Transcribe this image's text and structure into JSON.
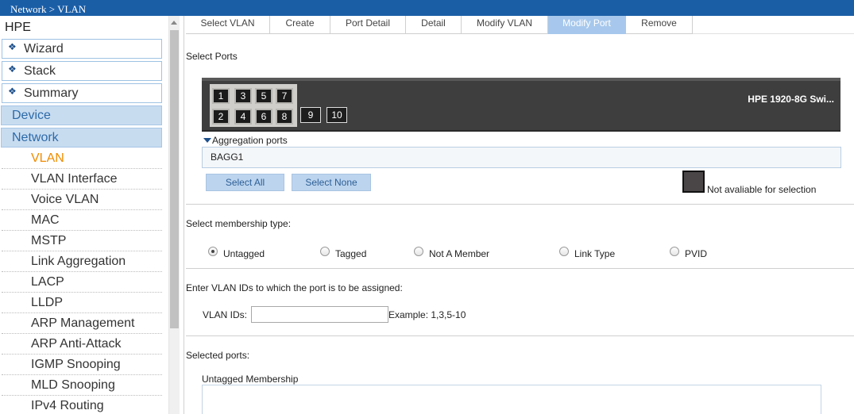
{
  "topbar": {
    "breadcrumb": "Network > VLAN"
  },
  "sidebar": {
    "root": "HPE",
    "groups": [
      {
        "label": "Wizard"
      },
      {
        "label": "Stack"
      },
      {
        "label": "Summary"
      }
    ],
    "sections": [
      {
        "label": "Device"
      },
      {
        "label": "Network"
      }
    ],
    "items": [
      {
        "label": "VLAN",
        "active": true
      },
      {
        "label": "VLAN Interface"
      },
      {
        "label": "Voice VLAN"
      },
      {
        "label": "MAC"
      },
      {
        "label": "MSTP"
      },
      {
        "label": "Link Aggregation"
      },
      {
        "label": "LACP"
      },
      {
        "label": "LLDP"
      },
      {
        "label": "ARP Management"
      },
      {
        "label": "ARP Anti-Attack"
      },
      {
        "label": "IGMP Snooping"
      },
      {
        "label": "MLD Snooping"
      },
      {
        "label": "IPv4 Routing"
      }
    ]
  },
  "tabs": [
    {
      "label": "Select VLAN"
    },
    {
      "label": "Create"
    },
    {
      "label": "Port Detail"
    },
    {
      "label": "Detail"
    },
    {
      "label": "Modify VLAN"
    },
    {
      "label": "Modify Port",
      "active": true
    },
    {
      "label": "Remove"
    }
  ],
  "select_ports": {
    "heading": "Select Ports",
    "switch_name": "HPE 1920-8G Swi...",
    "ports": [
      "1",
      "2",
      "3",
      "4",
      "5",
      "6",
      "7",
      "8",
      "9",
      "10"
    ],
    "aggregation_title": "Aggregation ports",
    "aggregation_value": "BAGG1",
    "select_all": "Select All",
    "select_none": "Select None",
    "not_available": "Not avaliable for selection"
  },
  "membership": {
    "heading": "Select membership type:",
    "options": [
      {
        "label": "Untagged",
        "checked": true
      },
      {
        "label": "Tagged"
      },
      {
        "label": "Not A Member"
      },
      {
        "label": "Link Type"
      },
      {
        "label": "PVID"
      }
    ]
  },
  "vlan_ids": {
    "heading": "Enter VLAN IDs to which the port is to be assigned:",
    "label": "VLAN IDs:",
    "value": "",
    "example": "Example: 1,3,5-10"
  },
  "selected_ports": {
    "heading": "Selected ports:",
    "untagged_label": "Untagged Membership"
  },
  "colors": {
    "topbar": "#1a5ea6",
    "active_tab": "#a7c8ec",
    "active_nav": "#f08c00",
    "section_bg": "#c8dcf0"
  }
}
